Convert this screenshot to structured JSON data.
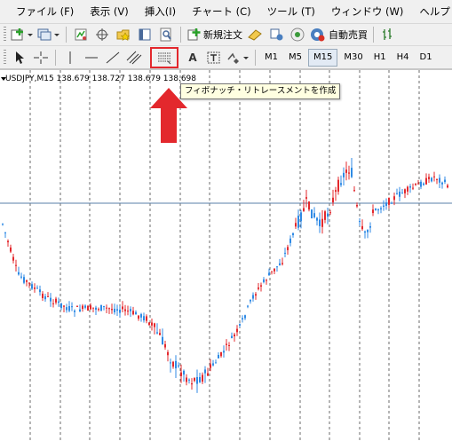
{
  "menu": [
    "ファイル (F)",
    "表示 (V)",
    "挿入(I)",
    "チャート (C)",
    "ツール (T)",
    "ウィンドウ (W)",
    "ヘルプ (H)"
  ],
  "toolbar1": {
    "new_order_label": "新規注文",
    "auto_trade_label": "自動売買"
  },
  "toolbar2": {
    "text_tool_label": "A",
    "timeframes": [
      "M1",
      "M5",
      "M15",
      "M30",
      "H1",
      "H4",
      "D1"
    ],
    "active_timeframe": "M15"
  },
  "chart": {
    "symbol_info": "USDJPY,M15  138.679 138.727 138.679 138.698"
  },
  "tooltip": {
    "text": "フィボナッチ・リトレースメントを作成"
  },
  "colors": {
    "bull": "#e3282d",
    "bear": "#2f8ae5",
    "highlight": "#e3282d",
    "grid": "#6b6b6b",
    "hline": "#5a7fa8"
  },
  "icons": [
    "new-chart-icon",
    "profiles-icon",
    "market-watch-icon",
    "crosshair-icon",
    "navigator-icon",
    "terminal-icon",
    "strategy-tester-icon",
    "new-order-icon",
    "metaeditor-icon",
    "signals-icon",
    "autotrading-icon",
    "cursor-icon",
    "crosshair-tool-icon",
    "vertical-line-icon",
    "horizontal-line-icon",
    "trendline-icon",
    "channel-icon",
    "fibonacci-icon",
    "text-label-icon",
    "shapes-dropdown-icon"
  ]
}
